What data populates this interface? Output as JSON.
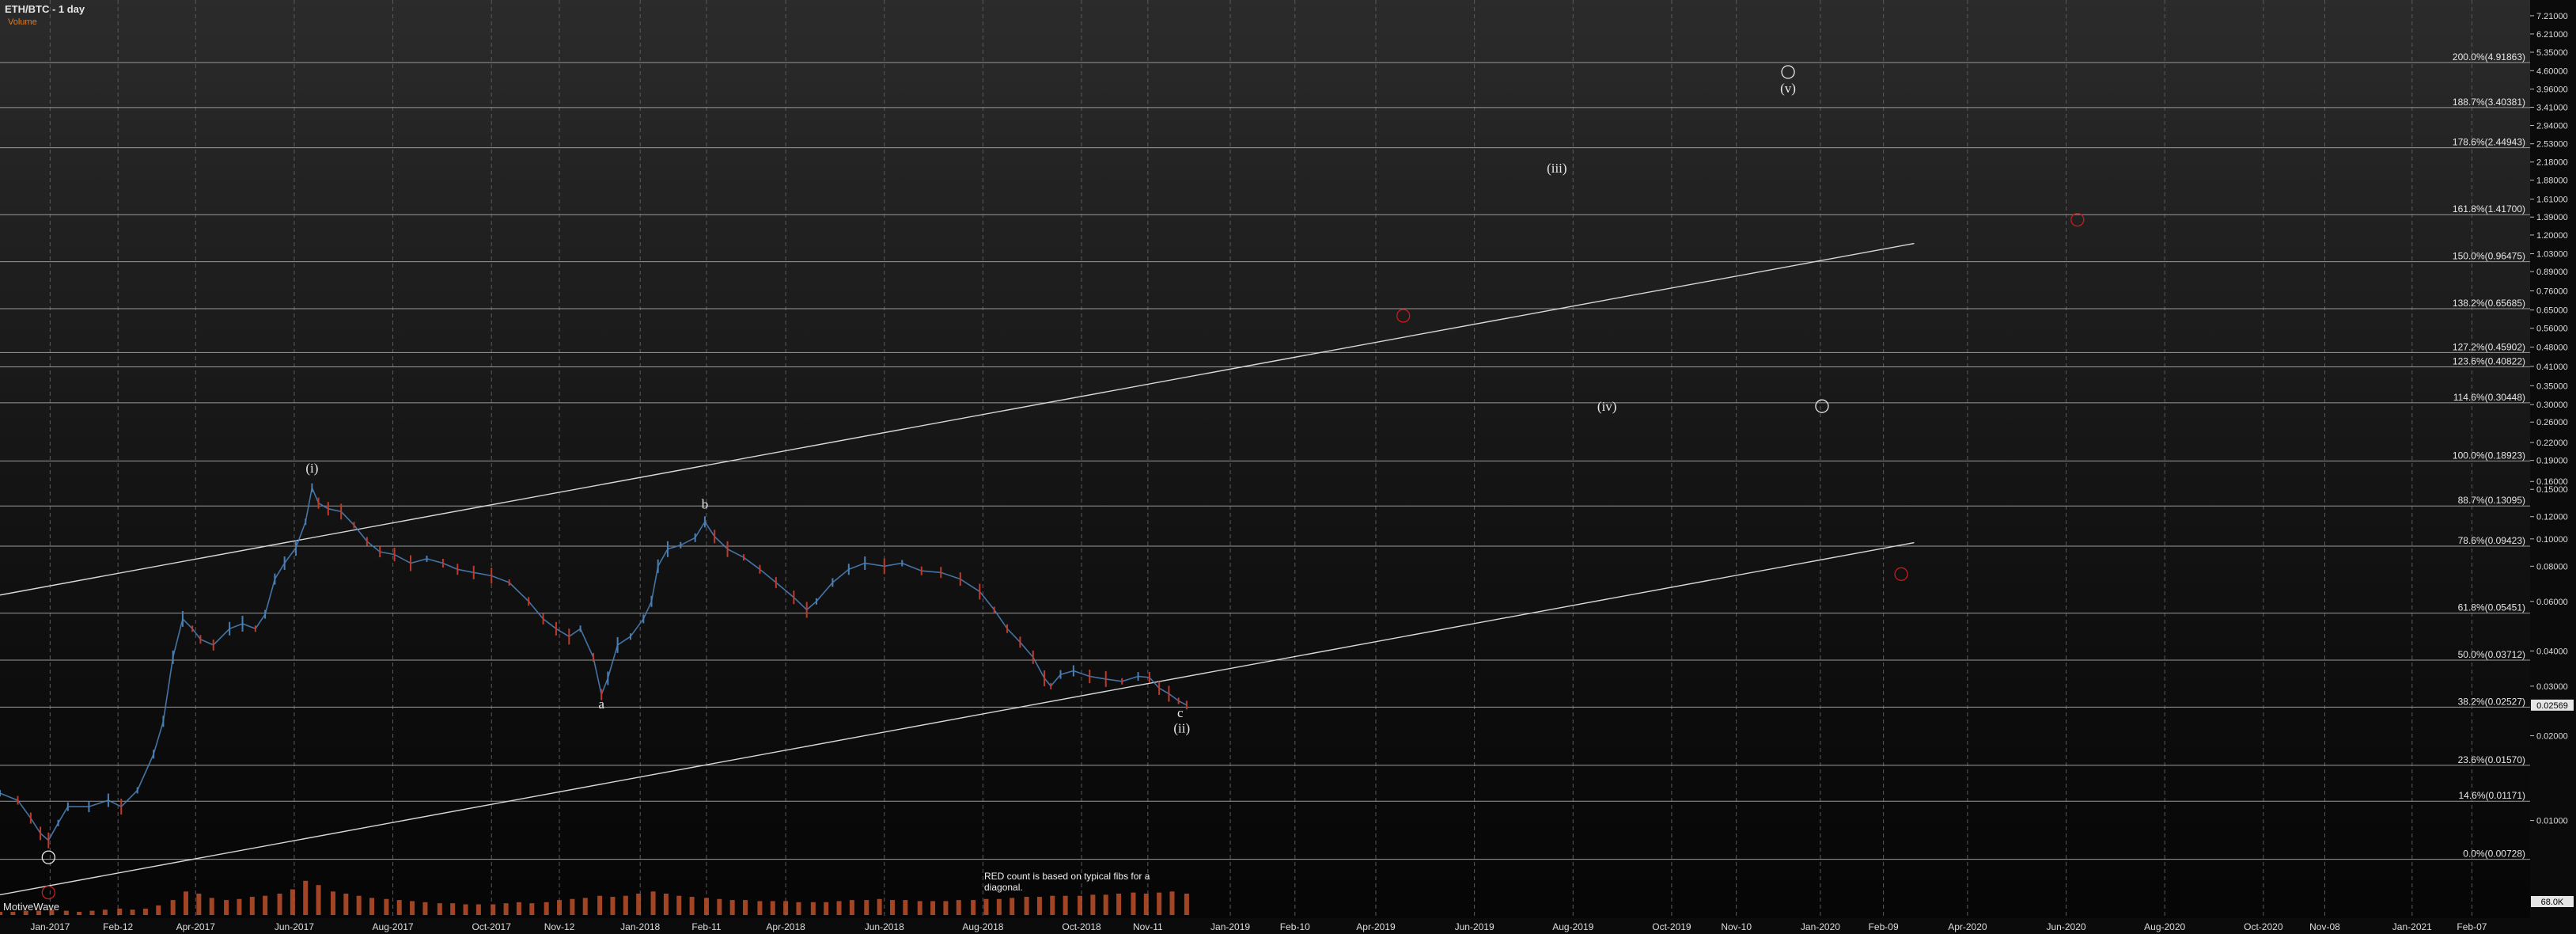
{
  "header": {
    "title": "ETH/BTC - 1 day",
    "subtitle": "Volume"
  },
  "watermark": "MotiveWave",
  "note": "RED count is based on typical fibs for a diagonal.",
  "colors": {
    "background": "#0b0b0b",
    "grid": "#5a5a5a",
    "bull": "#4a7fb5",
    "bear": "#c0392b",
    "wave_white": "#e8e8e8",
    "wave_red": "#cc1b1b",
    "volume": "#c0502b",
    "axis_text": "#dddddd",
    "trendline": "#d9d9d9"
  },
  "chart_data": {
    "type": "line",
    "yscale": "log",
    "ylim": [
      0.0045,
      8.2
    ],
    "x_ticks": [
      "Jan-2017",
      "Feb-12",
      "Apr-2017",
      "Jun-2017",
      "Aug-2017",
      "Oct-2017",
      "Nov-12",
      "Jan-2018",
      "Feb-11",
      "Apr-2018",
      "Jun-2018",
      "Aug-2018",
      "Oct-2018",
      "Nov-11",
      "Jan-2019",
      "Feb-10",
      "Apr-2019",
      "Jun-2019",
      "Aug-2019",
      "Oct-2019",
      "Nov-10",
      "Jan-2020",
      "Feb-09",
      "Apr-2020",
      "Jun-2020",
      "Aug-2020",
      "Oct-2020",
      "Nov-08",
      "Jan-2021",
      "Feb-07"
    ],
    "y_ticks": [
      "7.21000",
      "6.21000",
      "5.35000",
      "4.60000",
      "3.96000",
      "3.41000",
      "2.94000",
      "2.53000",
      "2.18000",
      "1.88000",
      "1.61000",
      "1.39000",
      "1.20000",
      "1.03000",
      "0.89000",
      "0.76000",
      "0.65000",
      "0.56000",
      "0.48000",
      "0.41000",
      "0.35000",
      "0.30000",
      "0.26000",
      "0.22000",
      "0.19000",
      "0.16000",
      "0.15000",
      "0.12000",
      "0.10000",
      "0.08000",
      "0.06000",
      "0.04000",
      "0.03000",
      "0.02000",
      "0.01000"
    ],
    "y_tick_values": [
      7.21,
      6.21,
      5.35,
      4.6,
      3.96,
      3.41,
      2.94,
      2.53,
      2.18,
      1.88,
      1.61,
      1.39,
      1.2,
      1.03,
      0.89,
      0.76,
      0.65,
      0.56,
      0.48,
      0.41,
      0.35,
      0.3,
      0.26,
      0.22,
      0.19,
      0.16,
      0.15,
      0.12,
      0.1,
      0.08,
      0.06,
      0.04,
      0.03,
      0.02,
      0.01
    ],
    "fib_levels": [
      {
        "label": "200.0%(4.91863)",
        "value": 4.91863
      },
      {
        "label": "188.7%(3.40381)",
        "value": 3.40381
      },
      {
        "label": "178.6%(2.44943)",
        "value": 2.44943
      },
      {
        "label": "161.8%(1.41700)",
        "value": 1.417
      },
      {
        "label": "150.0%(0.96475)",
        "value": 0.96475
      },
      {
        "label": "138.2%(0.65685)",
        "value": 0.65685
      },
      {
        "label": "127.2%(0.45902)",
        "value": 0.45902
      },
      {
        "label": "123.6%(0.40822)",
        "value": 0.40822
      },
      {
        "label": "114.6%(0.30448)",
        "value": 0.30448
      },
      {
        "label": "100.0%(0.18923)",
        "value": 0.18923
      },
      {
        "label": "88.7%(0.13095)",
        "value": 0.13095
      },
      {
        "label": "78.6%(0.09423)",
        "value": 0.09423
      },
      {
        "label": "61.8%(0.05451)",
        "value": 0.05451
      },
      {
        "label": "50.0%(0.03712)",
        "value": 0.03712
      },
      {
        "label": "38.2%(0.02527)",
        "value": 0.02527
      },
      {
        "label": "23.6%(0.01570)",
        "value": 0.0157
      },
      {
        "label": "14.6%(0.01171)",
        "value": 0.01171
      },
      {
        "label": "0.0%(0.00728)",
        "value": 0.00728
      }
    ],
    "last_price": "0.02569",
    "last_price_value": 0.02569,
    "volume_label": "68.0K",
    "price_path": [
      [
        "2016-12-01",
        0.0125
      ],
      [
        "2016-12-12",
        0.0118
      ],
      [
        "2016-12-20",
        0.0102
      ],
      [
        "2016-12-26",
        0.009
      ],
      [
        "2016-12-31",
        0.0085
      ],
      [
        "2017-01-06",
        0.0098
      ],
      [
        "2017-01-12",
        0.0112
      ],
      [
        "2017-01-25",
        0.0112
      ],
      [
        "2017-02-06",
        0.0118
      ],
      [
        "2017-02-14",
        0.0112
      ],
      [
        "2017-02-24",
        0.0128
      ],
      [
        "2017-03-06",
        0.0172
      ],
      [
        "2017-03-12",
        0.0225
      ],
      [
        "2017-03-18",
        0.038
      ],
      [
        "2017-03-24",
        0.052
      ],
      [
        "2017-03-30",
        0.048
      ],
      [
        "2017-04-04",
        0.044
      ],
      [
        "2017-04-12",
        0.042
      ],
      [
        "2017-04-22",
        0.048
      ],
      [
        "2017-04-30",
        0.05
      ],
      [
        "2017-05-08",
        0.048
      ],
      [
        "2017-05-14",
        0.054
      ],
      [
        "2017-05-20",
        0.072
      ],
      [
        "2017-05-26",
        0.082
      ],
      [
        "2017-06-02",
        0.093
      ],
      [
        "2017-06-08",
        0.115
      ],
      [
        "2017-06-12",
        0.152
      ],
      [
        "2017-06-16",
        0.134
      ],
      [
        "2017-06-22",
        0.128
      ],
      [
        "2017-06-30",
        0.125
      ],
      [
        "2017-07-08",
        0.112
      ],
      [
        "2017-07-16",
        0.098
      ],
      [
        "2017-07-24",
        0.09
      ],
      [
        "2017-08-02",
        0.088
      ],
      [
        "2017-08-12",
        0.082
      ],
      [
        "2017-08-22",
        0.085
      ],
      [
        "2017-09-01",
        0.082
      ],
      [
        "2017-09-10",
        0.078
      ],
      [
        "2017-09-20",
        0.076
      ],
      [
        "2017-10-01",
        0.074
      ],
      [
        "2017-10-12",
        0.07
      ],
      [
        "2017-10-24",
        0.06
      ],
      [
        "2017-11-02",
        0.052
      ],
      [
        "2017-11-10",
        0.048
      ],
      [
        "2017-11-18",
        0.045
      ],
      [
        "2017-11-25",
        0.048
      ],
      [
        "2017-12-03",
        0.038
      ],
      [
        "2017-12-08",
        0.028
      ],
      [
        "2017-12-12",
        0.032
      ],
      [
        "2017-12-18",
        0.042
      ],
      [
        "2017-12-26",
        0.045
      ],
      [
        "2018-01-03",
        0.052
      ],
      [
        "2018-01-08",
        0.06
      ],
      [
        "2018-01-12",
        0.08
      ],
      [
        "2018-01-18",
        0.092
      ],
      [
        "2018-01-26",
        0.095
      ],
      [
        "2018-02-04",
        0.101
      ],
      [
        "2018-02-10",
        0.115
      ],
      [
        "2018-02-16",
        0.102
      ],
      [
        "2018-02-24",
        0.092
      ],
      [
        "2018-03-06",
        0.086
      ],
      [
        "2018-03-16",
        0.078
      ],
      [
        "2018-03-26",
        0.07
      ],
      [
        "2018-04-06",
        0.062
      ],
      [
        "2018-04-14",
        0.056
      ],
      [
        "2018-04-20",
        0.06
      ],
      [
        "2018-04-30",
        0.07
      ],
      [
        "2018-05-10",
        0.078
      ],
      [
        "2018-05-20",
        0.082
      ],
      [
        "2018-06-01",
        0.08
      ],
      [
        "2018-06-12",
        0.082
      ],
      [
        "2018-06-24",
        0.077
      ],
      [
        "2018-07-06",
        0.076
      ],
      [
        "2018-07-18",
        0.072
      ],
      [
        "2018-07-30",
        0.065
      ],
      [
        "2018-08-08",
        0.056
      ],
      [
        "2018-08-16",
        0.048
      ],
      [
        "2018-08-24",
        0.043
      ],
      [
        "2018-09-01",
        0.038
      ],
      [
        "2018-09-08",
        0.032
      ],
      [
        "2018-09-12",
        0.03
      ],
      [
        "2018-09-18",
        0.033
      ],
      [
        "2018-09-26",
        0.034
      ],
      [
        "2018-10-06",
        0.0325
      ],
      [
        "2018-10-16",
        0.0318
      ],
      [
        "2018-10-26",
        0.0312
      ],
      [
        "2018-11-05",
        0.0325
      ],
      [
        "2018-11-12",
        0.0322
      ],
      [
        "2018-11-18",
        0.0295
      ],
      [
        "2018-11-24",
        0.0282
      ],
      [
        "2018-11-30",
        0.0266
      ],
      [
        "2018-12-05",
        0.0257
      ]
    ],
    "trendlines": [
      {
        "from": [
          "2016-12-01",
          0.0632
        ],
        "to": [
          "2020-02-28",
          1.12
        ]
      },
      {
        "from": [
          "2016-12-01",
          0.00545
        ],
        "to": [
          "2020-02-28",
          0.097
        ]
      }
    ],
    "wave_labels": [
      {
        "text": "(i)",
        "color": "white",
        "at": [
          "2017-06-12",
          0.172
        ]
      },
      {
        "text": "(ii)",
        "color": "white",
        "at": [
          "2018-12-02",
          0.0205
        ]
      },
      {
        "text": "(iii)",
        "color": "white",
        "at": [
          "2019-07-22",
          2.0
        ]
      },
      {
        "text": "(iv)",
        "color": "white",
        "at": [
          "2019-08-22",
          0.285
        ]
      },
      {
        "text": "(v)",
        "color": "white",
        "at": [
          "2019-12-12",
          3.85
        ]
      },
      {
        "text": "a",
        "color": "white",
        "at": [
          "2017-12-08",
          0.025
        ]
      },
      {
        "text": "b",
        "color": "white",
        "at": [
          "2018-02-10",
          0.128
        ]
      },
      {
        "text": "c",
        "color": "white",
        "at": [
          "2018-12-01",
          0.0233
        ]
      }
    ],
    "volume": [
      3,
      3,
      4,
      4,
      5,
      4,
      3,
      4,
      5,
      6,
      5,
      6,
      9,
      14,
      22,
      20,
      16,
      14,
      15,
      17,
      18,
      20,
      24,
      32,
      28,
      22,
      20,
      18,
      16,
      15,
      14,
      13,
      12,
      11,
      11,
      10,
      10,
      10,
      11,
      12,
      11,
      12,
      14,
      15,
      16,
      18,
      17,
      18,
      20,
      22,
      20,
      18,
      17,
      16,
      15,
      14,
      14,
      13,
      13,
      13,
      12,
      12,
      12,
      13,
      14,
      14,
      15,
      14,
      14,
      13,
      13,
      13,
      14,
      14,
      15,
      15,
      16,
      17,
      17,
      18,
      18,
      18,
      19,
      19,
      20,
      21,
      20,
      21,
      22,
      20
    ]
  }
}
